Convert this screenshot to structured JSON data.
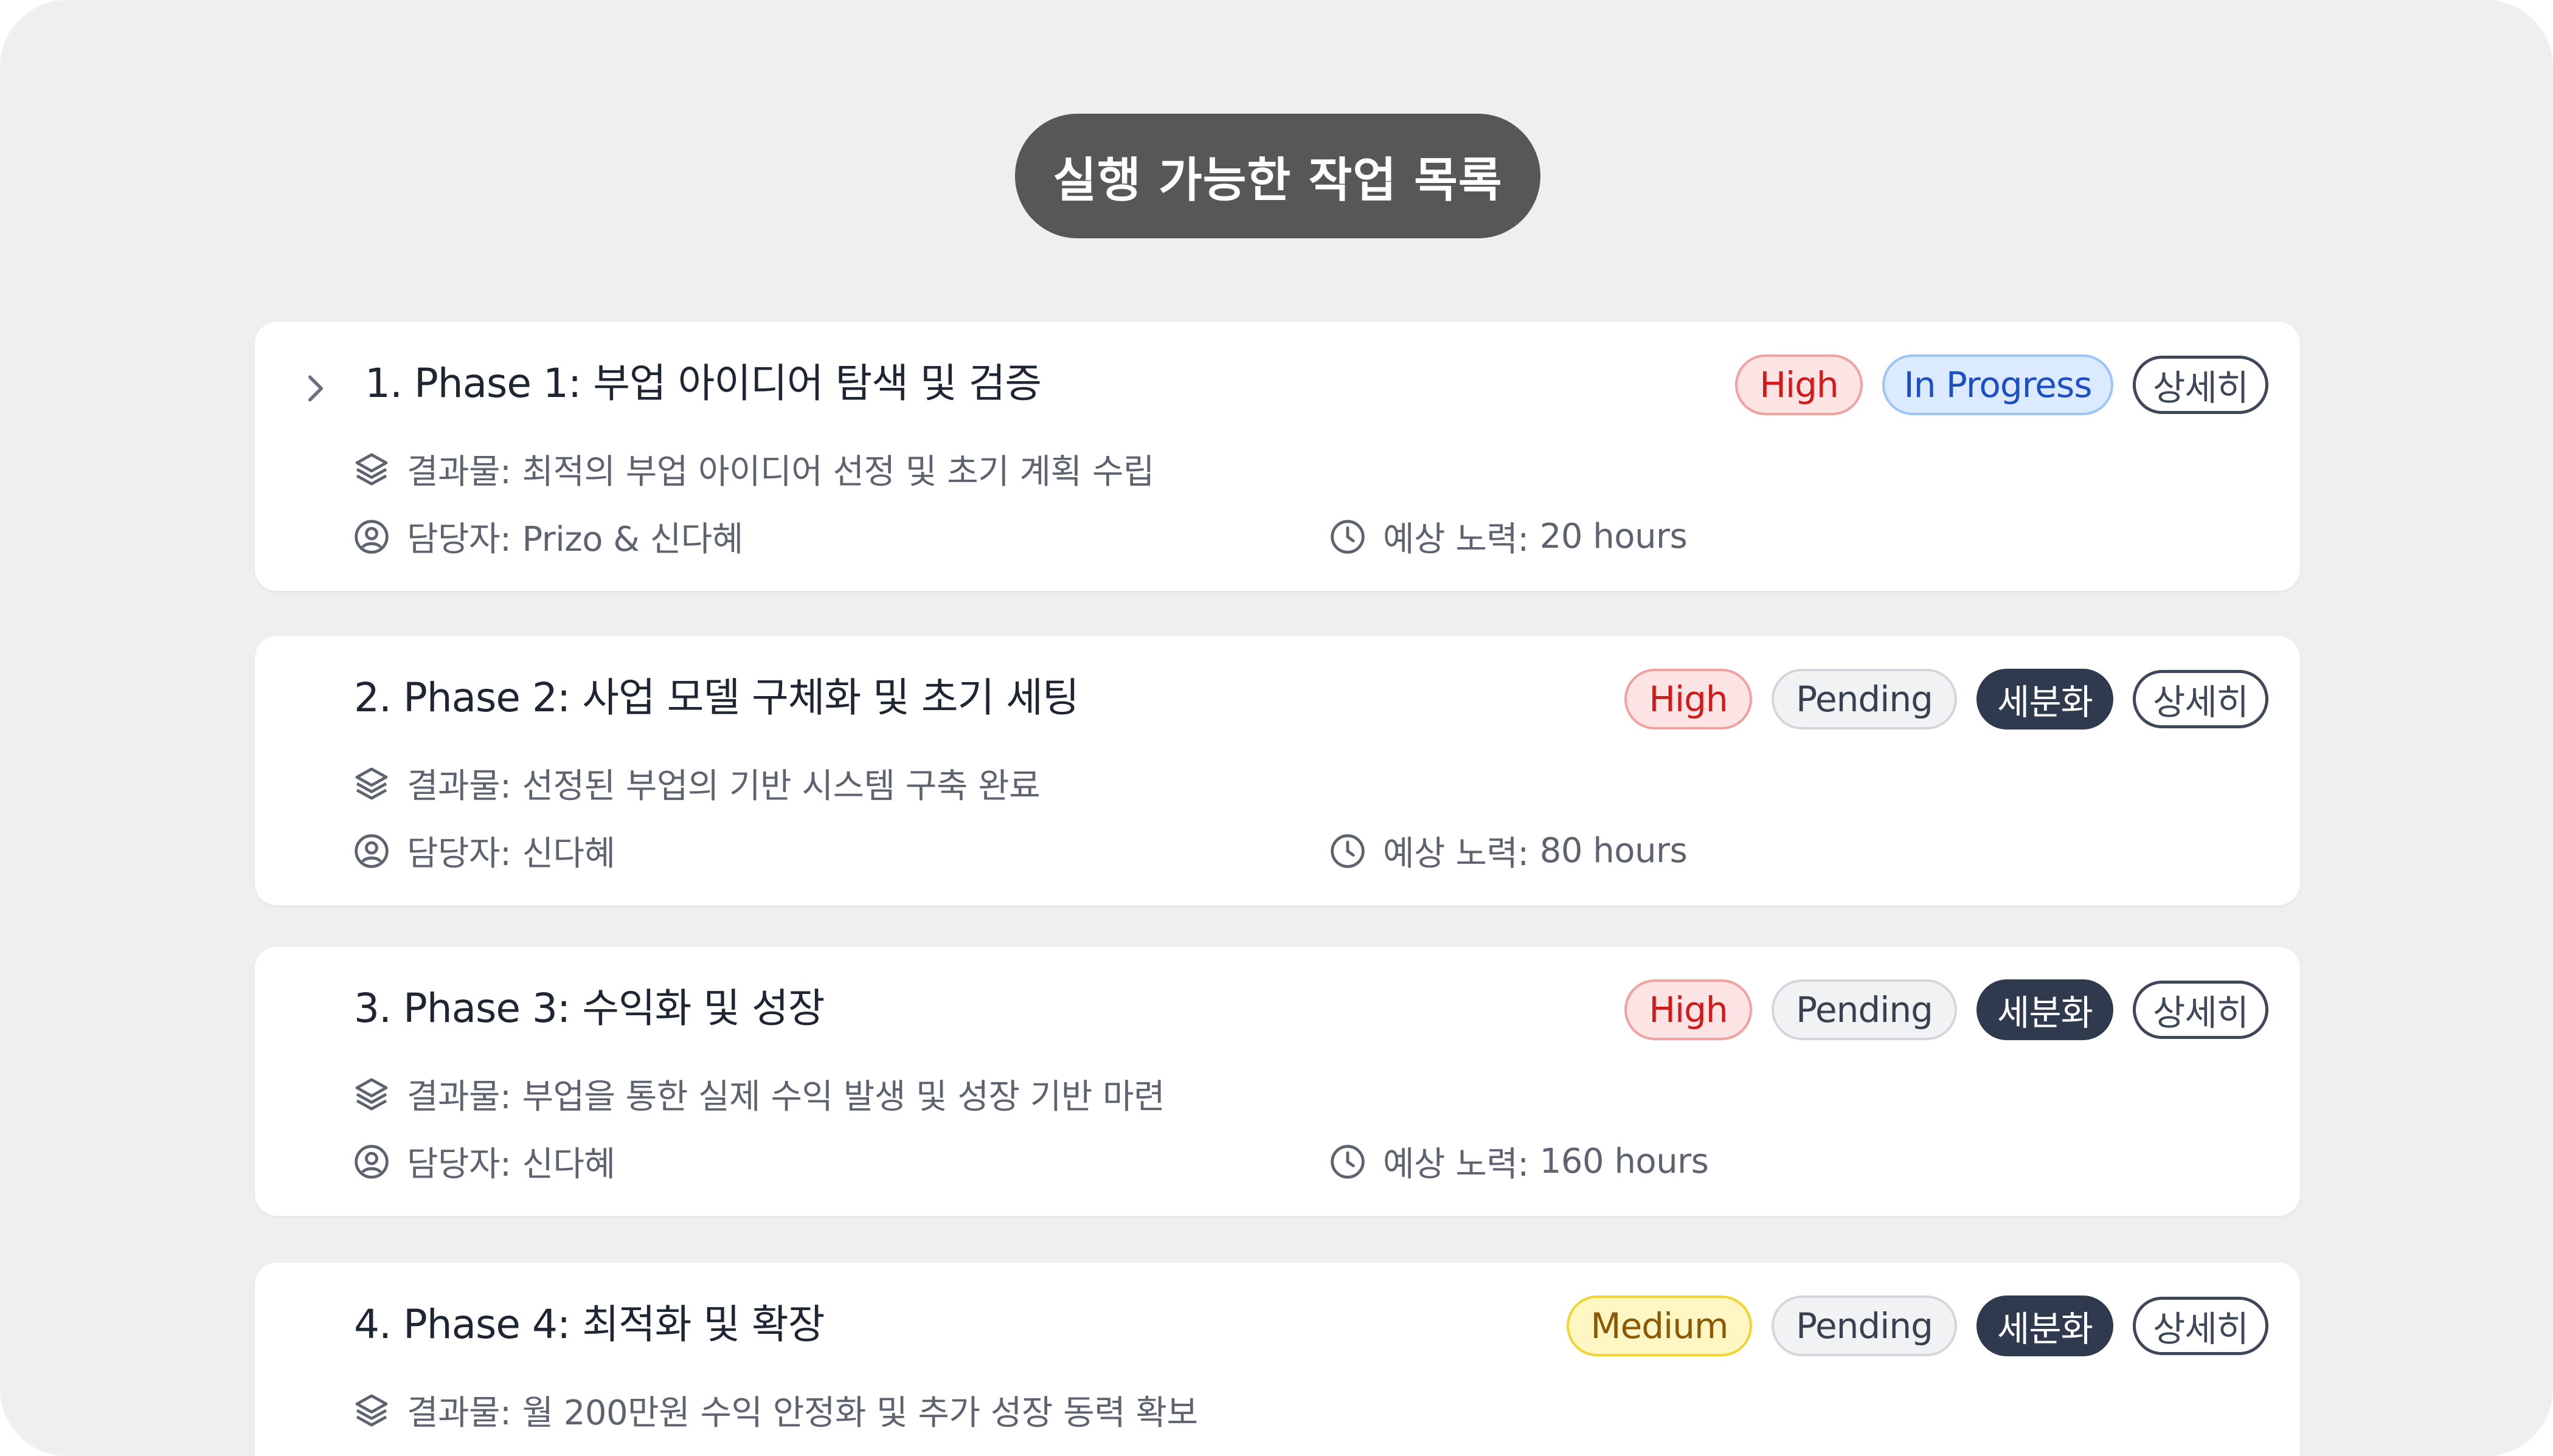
{
  "header": {
    "title": "실행 가능한 작업 목록"
  },
  "labels": {
    "deliverable": "결과물:",
    "assignee": "담당자:",
    "effort": "예상 노력:",
    "detail_button": "상세히",
    "breakdown_button": "세분화"
  },
  "tasks": [
    {
      "title": "1. Phase 1: 부업 아이디어 탐색 및 검증",
      "priority": "High",
      "status": "In Progress",
      "deliverable": "최적의 부업 아이디어 선정 및 초기 계획 수립",
      "assignee": "Prizo & 신다혜",
      "effort": "20 hours"
    },
    {
      "title": "2. Phase 2: 사업 모델 구체화 및 초기 세팅",
      "priority": "High",
      "status": "Pending",
      "deliverable": "선정된 부업의 기반 시스템 구축 완료",
      "assignee": "신다혜",
      "effort": "80 hours"
    },
    {
      "title": "3. Phase 3: 수익화 및 성장",
      "priority": "High",
      "status": "Pending",
      "deliverable": "부업을 통한 실제 수익 발생 및 성장 기반 마련",
      "assignee": "신다혜",
      "effort": "160 hours"
    },
    {
      "title": "4. Phase 4: 최적화 및 확장",
      "priority": "Medium",
      "status": "Pending",
      "deliverable": "월 200만원 수익 안정화 및 추가 성장 동력 확보"
    }
  ],
  "colors": {
    "background": "#efefef",
    "header_pill": "#575757",
    "high": "#d11a1a",
    "medium": "#8a5a06",
    "in_progress": "#1d4fc4",
    "breakdown_button": "#2f3a4f"
  },
  "icons": [
    "chevron-right-icon",
    "layers-icon",
    "user-circle-icon",
    "clock-icon"
  ]
}
